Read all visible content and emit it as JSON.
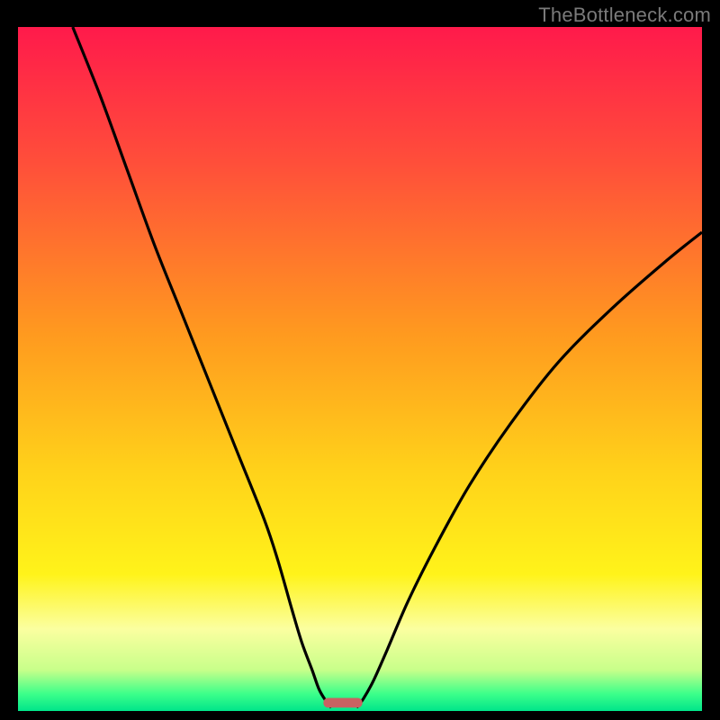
{
  "watermark": "TheBottleneck.com",
  "chart_data": {
    "type": "line",
    "title": "",
    "xlabel": "",
    "ylabel": "",
    "xlim": [
      0,
      100
    ],
    "ylim": [
      0,
      100
    ],
    "grid": false,
    "legend": false,
    "background_gradient_stops": [
      {
        "offset": 0.0,
        "color": "#ff1a4b"
      },
      {
        "offset": 0.2,
        "color": "#ff4f3a"
      },
      {
        "offset": 0.45,
        "color": "#ff9a1f"
      },
      {
        "offset": 0.65,
        "color": "#ffd21a"
      },
      {
        "offset": 0.8,
        "color": "#fff31a"
      },
      {
        "offset": 0.88,
        "color": "#fbffa0"
      },
      {
        "offset": 0.94,
        "color": "#c8ff8a"
      },
      {
        "offset": 0.975,
        "color": "#3cff8a"
      },
      {
        "offset": 1.0,
        "color": "#00e58a"
      }
    ],
    "series": [
      {
        "name": "left-branch",
        "x": [
          8,
          12,
          16,
          20,
          24,
          28,
          32,
          36,
          38,
          40,
          41.5,
          43,
          44,
          45,
          45.8
        ],
        "y": [
          100,
          90,
          79,
          68,
          58,
          48,
          38,
          28,
          22,
          15,
          10,
          6,
          3.2,
          1.5,
          0.5
        ]
      },
      {
        "name": "right-branch",
        "x": [
          49.5,
          50.5,
          52,
          54,
          57,
          61,
          66,
          72,
          79,
          87,
          95,
          100
        ],
        "y": [
          0.5,
          1.8,
          4.5,
          9,
          16,
          24,
          33,
          42,
          51,
          59,
          66,
          70
        ]
      }
    ],
    "marker": {
      "x_center": 47.5,
      "width": 5.7,
      "y": 0.5,
      "height": 1.4,
      "color": "#c96262"
    }
  }
}
